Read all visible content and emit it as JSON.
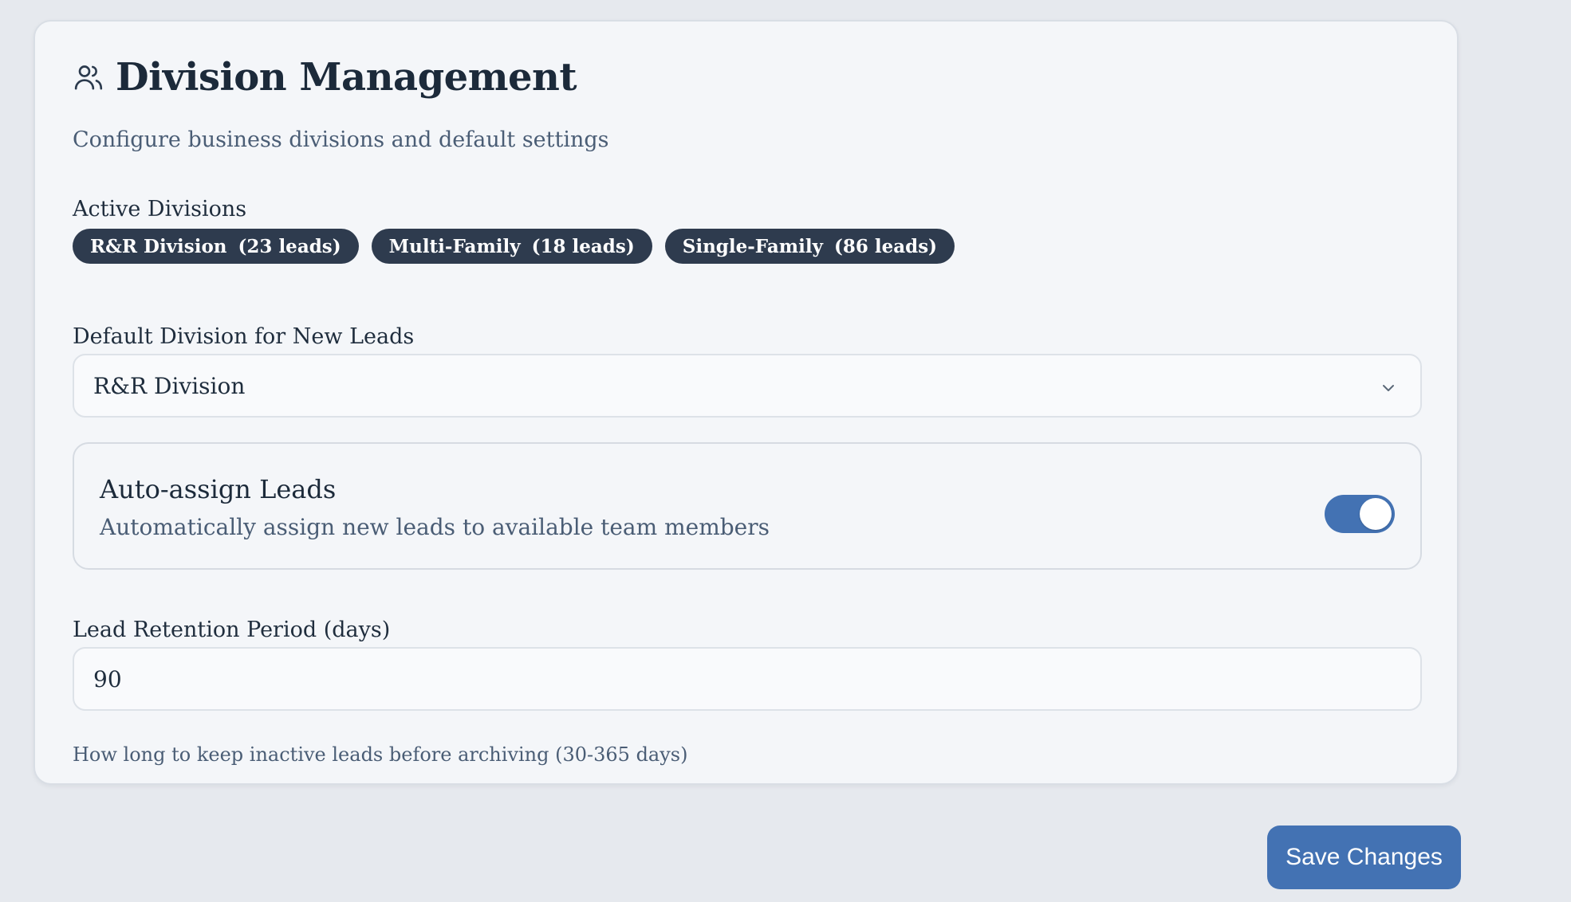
{
  "header": {
    "title": "Division Management",
    "subtitle": "Configure business divisions and default settings",
    "icon": "users-icon"
  },
  "active_divisions": {
    "label": "Active Divisions",
    "items": [
      {
        "name": "R&R Division",
        "count": "(23 leads)"
      },
      {
        "name": "Multi-Family",
        "count": "(18 leads)"
      },
      {
        "name": "Single-Family",
        "count": "(86 leads)"
      }
    ]
  },
  "default_division": {
    "label": "Default Division for New Leads",
    "value": "R&R Division",
    "icon": "chevron-down-icon"
  },
  "auto_assign": {
    "title": "Auto-assign Leads",
    "description": "Automatically assign new leads to available team members",
    "enabled": true
  },
  "retention": {
    "label": "Lead Retention Period (days)",
    "value": "90",
    "helper": "How long to keep inactive leads before archiving (30-365 days)"
  },
  "actions": {
    "save_label": "Save Changes"
  },
  "colors": {
    "accent": "#4372b3",
    "chip_bg": "#2e3b4e",
    "page_bg": "#e6e9ee",
    "card_bg": "#f4f6f9"
  }
}
